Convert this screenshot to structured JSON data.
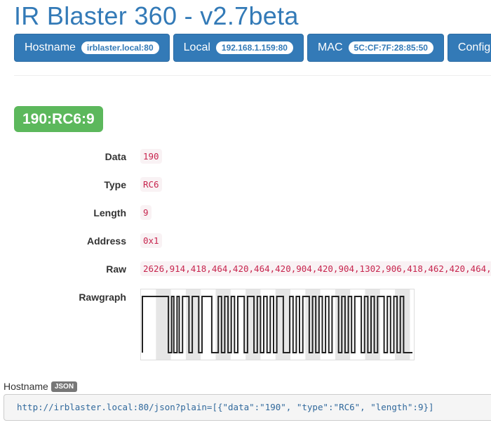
{
  "header": {
    "title": "IR Blaster 360 - v2.7beta",
    "buttons": [
      {
        "label": "Hostname",
        "badge": "irblaster.local:80"
      },
      {
        "label": "Local",
        "badge": "192.168.1.159:80"
      },
      {
        "label": "MAC",
        "badge": "5C:CF:7F:28:85:50"
      },
      {
        "label": "Config"
      }
    ]
  },
  "signal": {
    "code_label": "190:RC6:9",
    "fields": [
      {
        "label": "Data",
        "value": "190"
      },
      {
        "label": "Type",
        "value": "RC6"
      },
      {
        "label": "Length",
        "value": "9"
      },
      {
        "label": "Address",
        "value": "0x1"
      },
      {
        "label": "Raw",
        "value": "2626,914,418,464,420,464,420,904,420,904,1302,906,418,462,420,464,"
      }
    ],
    "rawgraph_label": "Rawgraph"
  },
  "footer": {
    "hostname_label": "Hostname",
    "json_badge": "JSON",
    "url": "http://irblaster.local:80/json?plain=[{\"data\":\"190\", \"type\":\"RC6\", \"length\":9}]"
  },
  "colors": {
    "primary": "#337ab7",
    "success": "#5cb85c",
    "code_text": "#c7254e",
    "code_bg": "#f9f2f4",
    "graph_stripe": "#e6e6e6",
    "graph_line": "#222222"
  }
}
